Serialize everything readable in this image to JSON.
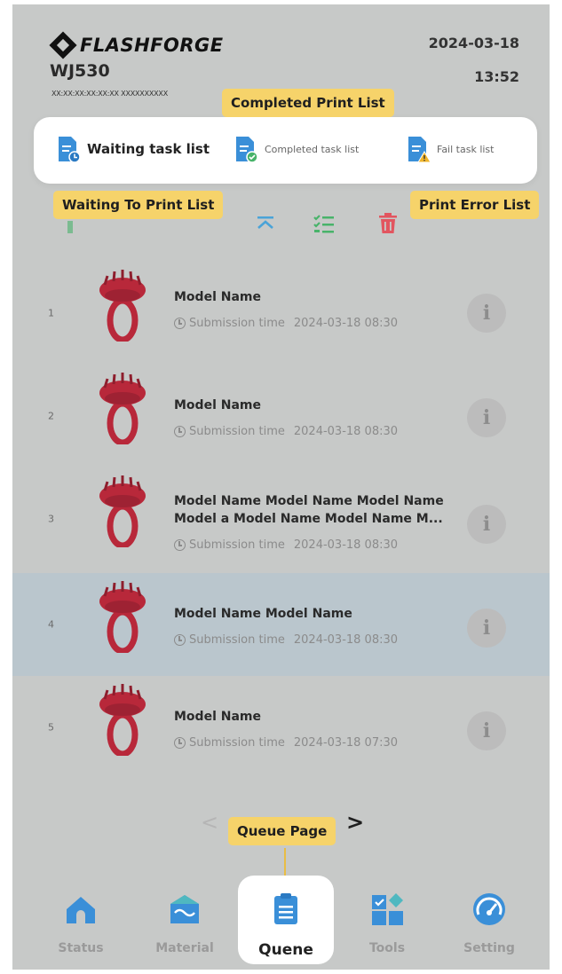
{
  "header": {
    "brand": "FLASHFORGE",
    "device_name": "WJ530",
    "device_ids": "XX:XX:XX:XX:XX:XX  XXXXXXXXXX",
    "date": "2024-03-18",
    "time": "13:52"
  },
  "tabs": [
    {
      "label": "Waiting task list",
      "icon": "waiting-doc-icon",
      "active": true
    },
    {
      "label": "Completed task list",
      "icon": "completed-doc-icon",
      "active": false
    },
    {
      "label": "Fail task list",
      "icon": "fail-doc-icon",
      "active": false
    }
  ],
  "callouts": {
    "completed": "Completed Print List",
    "waiting": "Waiting To Print List",
    "error": "Print Error List",
    "queue": "Queue Page"
  },
  "toolbar": {
    "icons": [
      "move-top-icon",
      "multi-select-icon",
      "delete-icon"
    ]
  },
  "queue": {
    "time_label": "Submission time",
    "items": [
      {
        "index": "1",
        "name": "Model Name",
        "time": "2024-03-18 08:30",
        "selected": false
      },
      {
        "index": "2",
        "name": "Model Name",
        "time": "2024-03-18 08:30",
        "selected": false
      },
      {
        "index": "3",
        "name": "Model Name Model Name Model Name Model a Model Name Model Name M...",
        "time": "2024-03-18 08:30",
        "selected": false
      },
      {
        "index": "4",
        "name": "Model Name Model Name",
        "time": "2024-03-18 08:30",
        "selected": true
      },
      {
        "index": "5",
        "name": "Model Name",
        "time": "2024-03-18 07:30",
        "selected": false
      }
    ]
  },
  "pagination": {
    "prev": "<",
    "next": ">"
  },
  "nav": [
    {
      "label": "Status",
      "icon": "home-icon",
      "active": false
    },
    {
      "label": "Material",
      "icon": "material-icon",
      "active": false
    },
    {
      "label": "Quene",
      "icon": "queue-icon",
      "active": true
    },
    {
      "label": "Tools",
      "icon": "tools-icon",
      "active": false
    },
    {
      "label": "Setting",
      "icon": "gauge-icon",
      "active": false
    }
  ],
  "colors": {
    "accent_blue": "#3a8fd8",
    "callout_yellow": "#f6d36a",
    "model_red": "#b8283a",
    "delete_red": "#e2555f",
    "check_green": "#48b36a"
  }
}
